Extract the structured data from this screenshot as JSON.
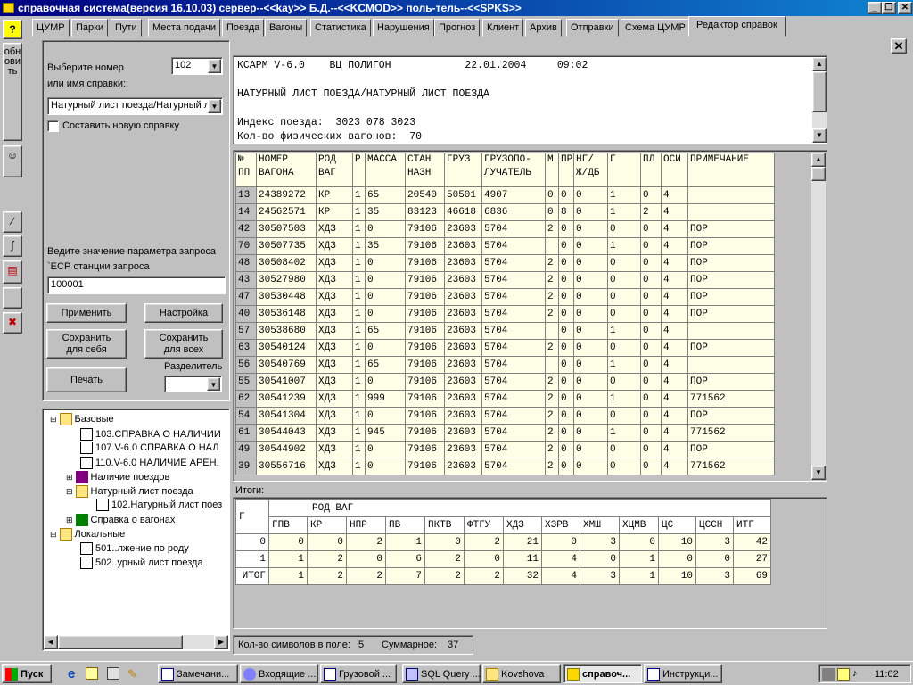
{
  "window": {
    "title": "справочная система(версия 16.10.03) сервер--<<kay>> Б.Д.--<<KCMOD>> поль-тель--<<SPKS>>"
  },
  "tabs": [
    "ЦУМР",
    "Парки",
    "Пути",
    "Места подачи",
    "Поезда",
    "Вагоны",
    "Статистика",
    "Нарушения",
    "Прогноз",
    "Клиент",
    "Архив",
    "Отправки",
    "Схема ЦУМР",
    "Редактор справок"
  ],
  "left_toolbar": {
    "help": "?",
    "refresh": "обновить"
  },
  "query": {
    "select_label_line1": "Выберите номер",
    "select_label_line2": "или имя справки:",
    "number_value": "102",
    "name_value": "Натурный лист поезда/Натурный лист п",
    "new_ref_checkbox": "Составить новую справку",
    "param_label": "Ведите значение параметра запроса",
    "param_name": "`ЕСР станции запроса",
    "param_value": "100001"
  },
  "buttons": {
    "apply": "Применить",
    "settings": "Настройка",
    "save_self_1": "Сохранить",
    "save_self_2": "для себя",
    "save_all_1": "Сохранить",
    "save_all_2": "для всех",
    "print": "Печать",
    "separator_label": "Разделитель",
    "separator_value": "|"
  },
  "tree": {
    "base": "Базовые",
    "i103": "103.СПРАВКА О НАЛИЧИИ",
    "i107": "107.V-6.0   СПРАВКА О НАЛ",
    "i110": "110.V-6.0   НАЛИЧИЕ АРЕН.",
    "trains": "Наличие поездов",
    "natural": "Натурный лист поезда",
    "i102": "102.Натурный лист поез",
    "wagons": "Справка о вагонах",
    "local": "Локальные",
    "i501": "501..лжение по роду",
    "i502": "502..урный лист поезда"
  },
  "report_header": {
    "line1": "КСАРМ V-6.0    ВЦ ПОЛИГОН            22.01.2004     09:02",
    "line2": "НАТУРНЫЙ ЛИСТ ПОЕЗДА/НАТУРНЫЙ ЛИСТ ПОЕЗДА",
    "line3": "Индекс поезда:  3023 078 3023",
    "line4": "Кол-во физических вагонов:  70"
  },
  "grid": {
    "headers": [
      [
        "№",
        "ПП"
      ],
      [
        "НОМЕР",
        "ВАГОНА"
      ],
      [
        "РОД",
        "ВАГ"
      ],
      [
        "Р",
        ""
      ],
      [
        "МАССА",
        ""
      ],
      [
        "СТАН",
        "НАЗН"
      ],
      [
        "ГРУЗ",
        ""
      ],
      [
        "ГРУЗОПО-",
        "ЛУЧАТЕЛЬ"
      ],
      [
        "М",
        ""
      ],
      [
        "ПР",
        ""
      ],
      [
        "НГ/",
        "Ж/ДБ"
      ],
      [
        "Г",
        ""
      ],
      [
        "ПЛ",
        ""
      ],
      [
        "ОСИ",
        ""
      ],
      [
        "ПРИМЕЧАНИЕ",
        ""
      ]
    ],
    "rows": [
      [
        "13",
        "24389272",
        "КР",
        "1",
        "65",
        "20540",
        "50501",
        "4907",
        "0",
        "0",
        "0",
        "1",
        "0",
        "4",
        ""
      ],
      [
        "14",
        "24562571",
        "КР",
        "1",
        "35",
        "83123",
        "46618",
        "6836",
        "0",
        "8",
        "0",
        "1",
        "2",
        "4",
        ""
      ],
      [
        "42",
        "30507503",
        "ХДЗ",
        "1",
        "0",
        "79106",
        "23603",
        "5704",
        "2",
        "0",
        "0",
        "0",
        "0",
        "4",
        "ПОР"
      ],
      [
        "70",
        "30507735",
        "ХДЗ",
        "1",
        "35",
        "79106",
        "23603",
        "5704",
        "",
        "0",
        "0",
        "1",
        "0",
        "4",
        "ПОР"
      ],
      [
        "48",
        "30508402",
        "ХДЗ",
        "1",
        "0",
        "79106",
        "23603",
        "5704",
        "2",
        "0",
        "0",
        "0",
        "0",
        "4",
        "ПОР"
      ],
      [
        "43",
        "30527980",
        "ХДЗ",
        "1",
        "0",
        "79106",
        "23603",
        "5704",
        "2",
        "0",
        "0",
        "0",
        "0",
        "4",
        "ПОР"
      ],
      [
        "47",
        "30530448",
        "ХДЗ",
        "1",
        "0",
        "79106",
        "23603",
        "5704",
        "2",
        "0",
        "0",
        "0",
        "0",
        "4",
        "ПОР"
      ],
      [
        "40",
        "30536148",
        "ХДЗ",
        "1",
        "0",
        "79106",
        "23603",
        "5704",
        "2",
        "0",
        "0",
        "0",
        "0",
        "4",
        "ПОР"
      ],
      [
        "57",
        "30538680",
        "ХДЗ",
        "1",
        "65",
        "79106",
        "23603",
        "5704",
        "",
        "0",
        "0",
        "1",
        "0",
        "4",
        ""
      ],
      [
        "63",
        "30540124",
        "ХДЗ",
        "1",
        "0",
        "79106",
        "23603",
        "5704",
        "2",
        "0",
        "0",
        "0",
        "0",
        "4",
        "ПОР"
      ],
      [
        "56",
        "30540769",
        "ХДЗ",
        "1",
        "65",
        "79106",
        "23603",
        "5704",
        "",
        "0",
        "0",
        "1",
        "0",
        "4",
        ""
      ],
      [
        "55",
        "30541007",
        "ХДЗ",
        "1",
        "0",
        "79106",
        "23603",
        "5704",
        "2",
        "0",
        "0",
        "0",
        "0",
        "4",
        "ПОР"
      ],
      [
        "62",
        "30541239",
        "ХДЗ",
        "1",
        "999",
        "79106",
        "23603",
        "5704",
        "2",
        "0",
        "0",
        "1",
        "0",
        "4",
        "771562"
      ],
      [
        "54",
        "30541304",
        "ХДЗ",
        "1",
        "0",
        "79106",
        "23603",
        "5704",
        "2",
        "0",
        "0",
        "0",
        "0",
        "4",
        "ПОР"
      ],
      [
        "61",
        "30544043",
        "ХДЗ",
        "1",
        "945",
        "79106",
        "23603",
        "5704",
        "2",
        "0",
        "0",
        "1",
        "0",
        "4",
        "771562"
      ],
      [
        "49",
        "30544902",
        "ХДЗ",
        "1",
        "0",
        "79106",
        "23603",
        "5704",
        "2",
        "0",
        "0",
        "0",
        "0",
        "4",
        "ПОР"
      ],
      [
        "39",
        "30556716",
        "ХДЗ",
        "1",
        "0",
        "79106",
        "23603",
        "5704",
        "2",
        "0",
        "0",
        "0",
        "0",
        "4",
        "771562"
      ]
    ]
  },
  "totals": {
    "label": "Итоги:",
    "group_header": "РОД ВАГ",
    "g_header": "Г",
    "cols": [
      "ГПВ",
      "КР",
      "НПР",
      "ПВ",
      "ПКТВ",
      "ФТГУ",
      "ХДЗ",
      "ХЗРВ",
      "ХМШ",
      "ХЦМВ",
      "ЦС",
      "ЦССН",
      "ИТГ"
    ],
    "rows": [
      [
        "0",
        "0",
        "0",
        "2",
        "1",
        "0",
        "2",
        "21",
        "0",
        "3",
        "0",
        "10",
        "3",
        "42"
      ],
      [
        "1",
        "1",
        "2",
        "0",
        "6",
        "2",
        "0",
        "11",
        "4",
        "0",
        "1",
        "0",
        "0",
        "27"
      ],
      [
        "ИТОГ",
        "1",
        "2",
        "2",
        "7",
        "2",
        "2",
        "32",
        "4",
        "3",
        "1",
        "10",
        "3",
        "69"
      ]
    ]
  },
  "status": {
    "chars_label": "Кол-во символов в поле:",
    "chars_value": "5",
    "sum_label": "Суммарное:",
    "sum_value": "37"
  },
  "taskbar": {
    "start": "Пуск",
    "tasks": [
      "Замечани...",
      "Входящие ...",
      "Грузовой ...",
      "SQL Query ...",
      "Kovshova",
      "справоч...",
      "Инструкци..."
    ],
    "clock": "11:02"
  }
}
